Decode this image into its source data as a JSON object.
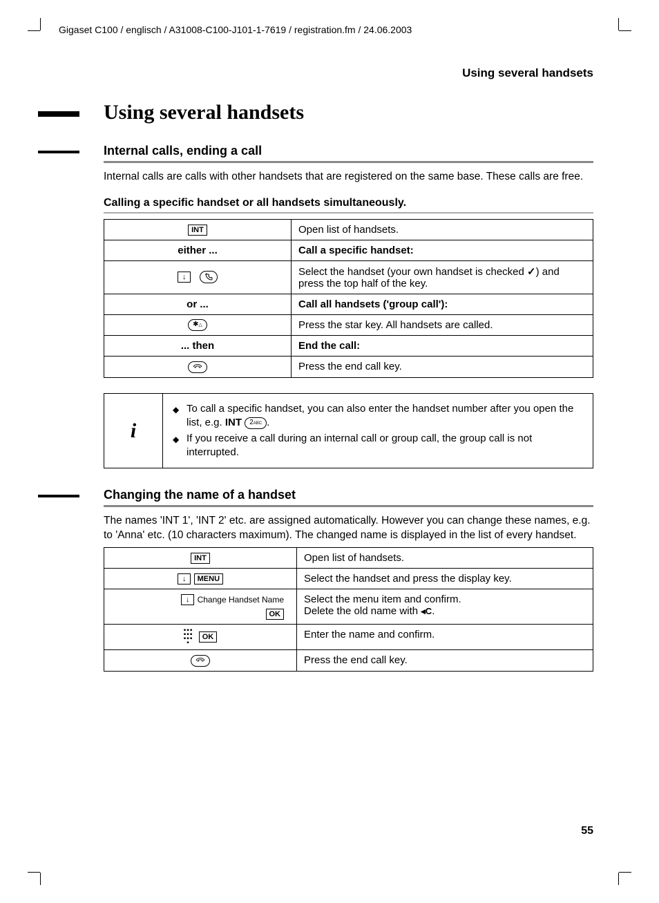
{
  "header_path": "Gigaset C100 / englisch / A31008-C100-J101-1-7619 / registration.fm / 24.06.2003",
  "running_head": "Using several handsets",
  "h1": "Using several handsets",
  "section1": {
    "title": "Internal calls, ending a call",
    "intro": "Internal calls are calls with other handsets that are registered on the same base. These calls are free.",
    "sub_title": "Calling a specific handset or all handsets simultaneously.",
    "rows": {
      "r1_left_key": "INT",
      "r1_right": "Open list of handsets.",
      "r2_left": "either ...",
      "r2_right": "Call a specific handset:",
      "r3_right_a": "Select the handset (your own handset is checked ",
      "r3_right_b": ") and press the top half of the key.",
      "r4_left": "or ...",
      "r4_right": "Call all handsets ('group call'):",
      "r5_right": "Press the star key. All handsets are called.",
      "r6_left": "... then",
      "r6_right": "End the call:",
      "r7_right": "Press the end call key."
    }
  },
  "note": {
    "icon": "i",
    "item1_a": "To call a specific handset, you can also enter the handset number after you open the list, e.g. ",
    "item1_b": "INT",
    "item1_c": ".",
    "key2": "2",
    "key2_sub": "ABC",
    "item2": "If you receive a call during an internal call or group call, the group call is not interrupted."
  },
  "section2": {
    "title": "Changing the name of a handset",
    "intro": "The names 'INT 1', 'INT 2' etc. are assigned automatically. However you can change these names, e.g. to 'Anna' etc. (10 characters maximum). The changed name is displayed in the list of every handset.",
    "rows": {
      "r1_left_key": "INT",
      "r1_right": "Open list of handsets.",
      "r2_menu": "MENU",
      "r2_right": "Select the handset and press the display key.",
      "r3_item": "Change Handset Name",
      "r3_ok": "OK",
      "r3_right_a": "Select the menu item and confirm.",
      "r3_right_b": "Delete the old name with ",
      "r3_right_c": ".",
      "clear_key": "C",
      "r4_ok": "OK",
      "r4_right": "Enter the name and confirm.",
      "r5_right": "Press the end call key."
    }
  },
  "page_number": "55",
  "icons": {
    "down_arrow": "↓",
    "star": "✱",
    "end_call": "☎",
    "check": "✓",
    "clear_arrow": "◂"
  }
}
